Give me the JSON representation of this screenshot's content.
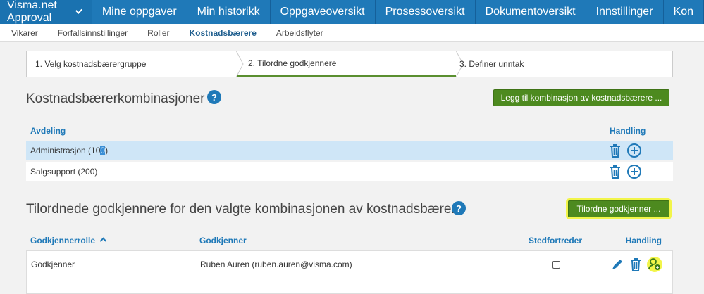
{
  "app": {
    "title": "Visma.net Approval"
  },
  "nav": {
    "items": [
      "Mine oppgaver",
      "Min historikk",
      "Oppgaveoversikt",
      "Prosessoversikt",
      "Dokumentoversikt",
      "Innstillinger",
      "Kon"
    ]
  },
  "subnav": {
    "items": [
      "Vikarer",
      "Forfallsinnstillinger",
      "Roller",
      "Kostnadsbærere",
      "Arbeidsflyter"
    ],
    "active": "Kostnadsbærere"
  },
  "wizard": {
    "steps": [
      "1. Velg kostnadsbærergruppe",
      "2. Tilordne godkjennere",
      "3. Definer unntak"
    ],
    "active_step": 2
  },
  "combinations": {
    "title": "Kostnadsbærerkombinasjoner",
    "add_button": "Legg til kombinasjon av kostnadsbærere ...",
    "col_department": "Avdeling",
    "col_action": "Handling",
    "rows": [
      {
        "name_prefix": "Administrasjon (10",
        "name_selected": "0",
        "name_suffix": ")"
      },
      {
        "name_prefix": "Salgsupport (200)",
        "name_selected": "",
        "name_suffix": ""
      }
    ]
  },
  "approvers": {
    "title": "Tilordnede godkjennere for den valgte kombinasjonen av kostnadsbærere",
    "assign_button": "Tilordne godkjenner ...",
    "col_role": "Godkjennerrolle",
    "col_approver": "Godkjenner",
    "col_substitute": "Stedfortreder",
    "col_action": "Handling",
    "rows": [
      {
        "role": "Godkjenner",
        "approver": "Ruben Auren (ruben.auren@visma.com)",
        "substitute": false
      }
    ]
  },
  "colors": {
    "brand": "#1f79b8",
    "action_green": "#4d8a1f",
    "highlight": "#f2f54a",
    "selected_row": "#cfe6f7"
  }
}
